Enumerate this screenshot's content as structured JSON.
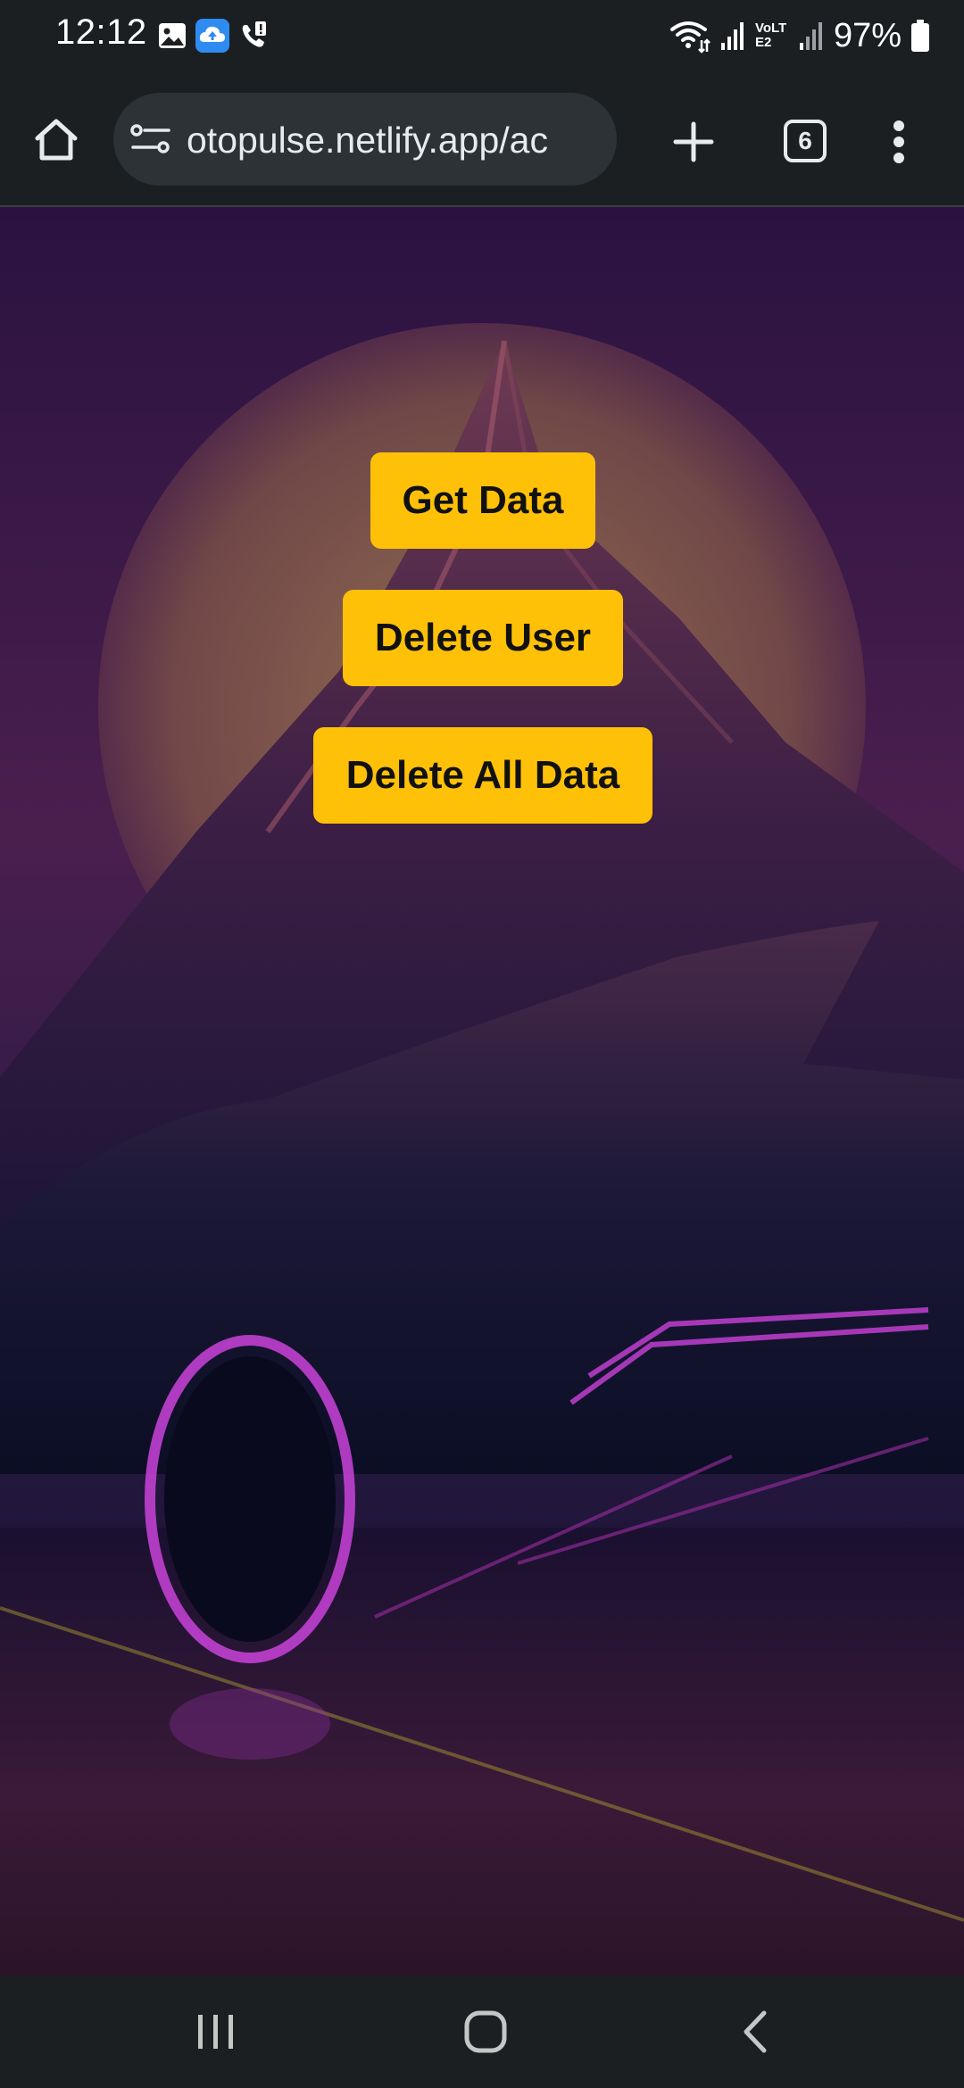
{
  "status_bar": {
    "time": "12:12",
    "battery_percent": "97%",
    "network_label": "VoLTE2",
    "battery_level": 0.97
  },
  "browser": {
    "url": "otopulse.netlify.app/ac",
    "tab_count": "6",
    "icons": {
      "home": "home-icon",
      "site_settings": "site-settings-icon",
      "new_tab": "plus-icon",
      "tabs": "tab-switcher-icon",
      "menu": "more-vertical-icon"
    }
  },
  "page": {
    "buttons": {
      "get_data": "Get Data",
      "delete_user": "Delete User",
      "delete_all": "Delete All Data"
    },
    "colors": {
      "button_bg": "#ffc107",
      "button_text": "#111111"
    }
  },
  "nav_bar": {
    "icons": {
      "recents": "recents-icon",
      "home": "home-circle-icon",
      "back": "back-chevron-icon"
    }
  }
}
